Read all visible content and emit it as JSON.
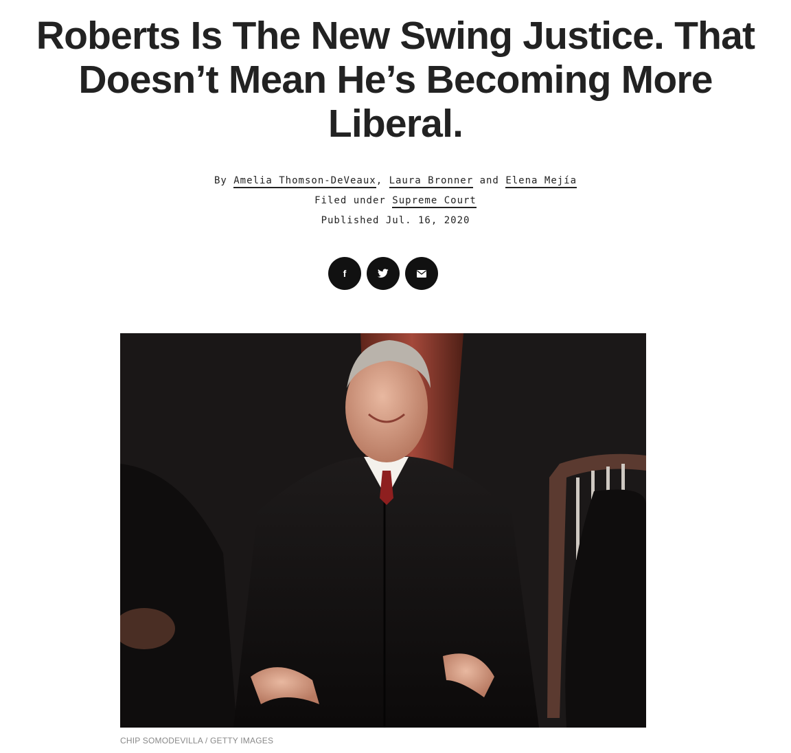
{
  "article": {
    "headline": "Roberts Is The New Swing Justice. That Doesn’t Mean He’s Becoming More Liberal.",
    "byline": {
      "prefix": "By",
      "authors": [
        "Amelia Thomson-DeVeaux",
        "Laura Bronner",
        "Elena Mejía"
      ],
      "comma": ",",
      "and": "and"
    },
    "filed": {
      "label": "Filed under",
      "category": "Supreme Court"
    },
    "published": "Published Jul. 16, 2020",
    "share": [
      {
        "icon": "facebook-icon",
        "glyph": "f"
      },
      {
        "icon": "twitter-icon"
      },
      {
        "icon": "email-icon"
      }
    ],
    "photo": {
      "caption": "CHIP SOMODEVILLA / GETTY IMAGES"
    }
  },
  "colors": {
    "text": "#222222",
    "button": "#111111",
    "caption": "#888888",
    "curtain": "#8a3a2a"
  }
}
